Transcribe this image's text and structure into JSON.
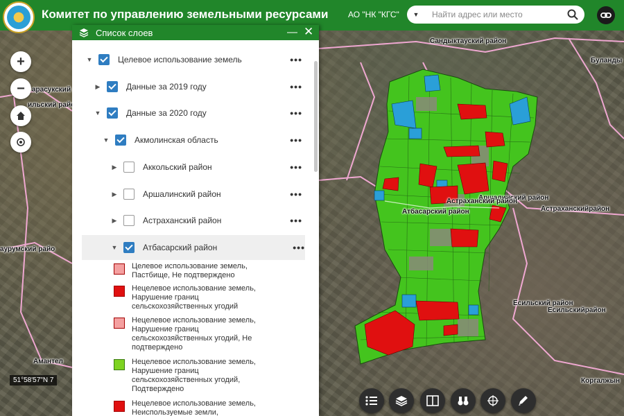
{
  "header": {
    "title": "Комитет по управлению земельными ресурсами",
    "org_label": "АО \"НК \"КГС\"",
    "search_placeholder": "Найти адрес или место"
  },
  "coords": "51°58'57\"N 7",
  "panel": {
    "title": "Список слоев",
    "min_label": "—",
    "close_label": "✕",
    "dots": "•••",
    "rows": [
      {
        "label": "Целевое использование земель",
        "checked": true,
        "expanded": true
      },
      {
        "label": "Данные за 2019 году",
        "checked": true,
        "expanded": false
      },
      {
        "label": "Данные за 2020 году",
        "checked": true,
        "expanded": true
      },
      {
        "label": "Акмолинская область",
        "checked": true,
        "expanded": true
      },
      {
        "label": "Аккольский район",
        "checked": false,
        "expanded": false
      },
      {
        "label": "Аршалинский район",
        "checked": false,
        "expanded": false
      },
      {
        "label": "Астраханский район",
        "checked": false,
        "expanded": false
      },
      {
        "label": "Атбасарский район",
        "checked": true,
        "expanded": true
      }
    ],
    "legend": [
      {
        "label": "Целевое использование земель, Пастбище, Не подтверждено",
        "color": "#f4a0a0"
      },
      {
        "label": "Нецелевое использование земель, Нарушение границ сельскохозяйственных угодий",
        "color": "#e01010"
      },
      {
        "label": "Нецелевое использование земель, Нарушение границ сельскохозяйственных угодий, Не подтверждено",
        "color": "#f4a0a0"
      },
      {
        "label": "Нецелевое использование земель, Нарушение границ сельскохозяйственных угодий, Подтверждено",
        "color": "#7ed321"
      },
      {
        "label": "Нецелевое использование земель, Неиспользуемые земли,",
        "color": "#e01010"
      }
    ]
  },
  "map_labels": [
    {
      "text": "Сандыктауский район"
    },
    {
      "text": "Буланды"
    },
    {
      "text": "арасукский р"
    },
    {
      "text": "ильский райо"
    },
    {
      "text": "Аршалинский район"
    },
    {
      "text": "Атбасарский район"
    },
    {
      "text": "Астраханский район"
    },
    {
      "text": "Астраханскийрайон"
    },
    {
      "text": "аурумский райо"
    },
    {
      "text": "Есильский район"
    },
    {
      "text": "Есильскийрайон"
    },
    {
      "text": "Амантел"
    },
    {
      "text": "Коргалжын"
    }
  ],
  "toolbar": [
    {
      "icon": "list-icon"
    },
    {
      "icon": "layers-icon"
    },
    {
      "icon": "compare-icon"
    },
    {
      "icon": "binoculars-icon"
    },
    {
      "icon": "coordinates-icon"
    },
    {
      "icon": "draw-icon"
    }
  ],
  "colors": {
    "header": "#21862a",
    "checkbox": "#2f7dc1",
    "parcel_green": "#44c41e",
    "parcel_red": "#e01010",
    "parcel_blue": "#2a9fd8",
    "boundary": "#ffb0e0"
  }
}
